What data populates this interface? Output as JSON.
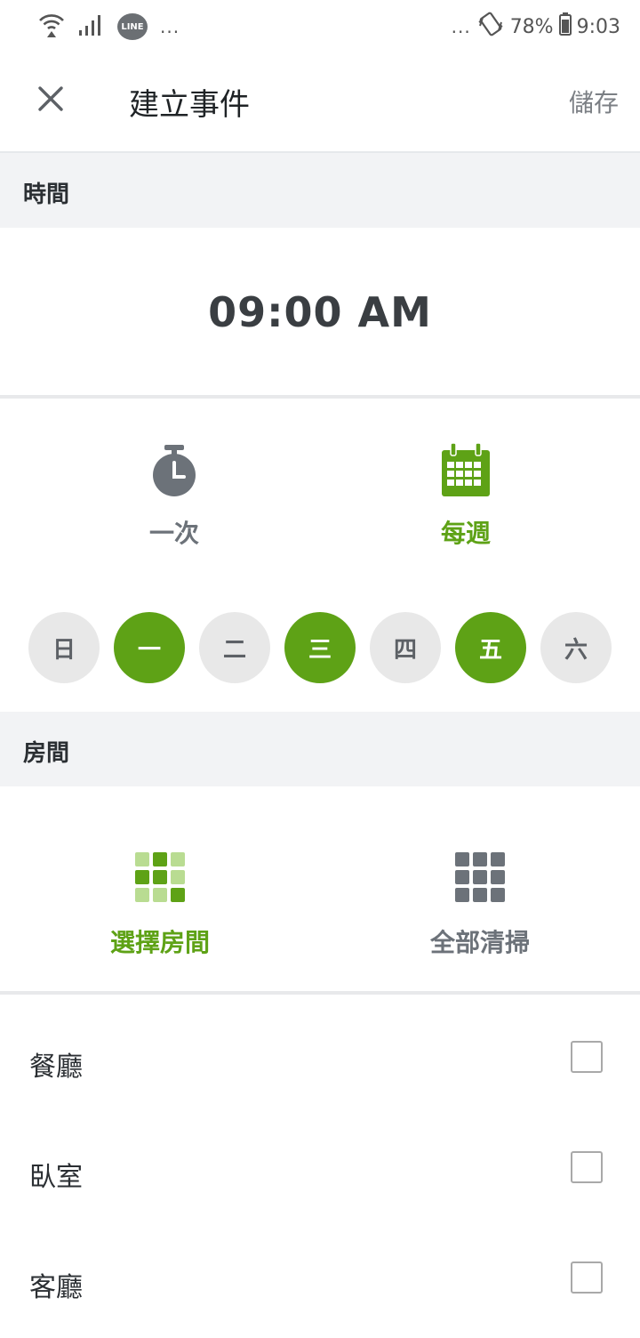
{
  "status_bar": {
    "dots_left": "...",
    "line_label": "LINE",
    "dots_right": "...",
    "battery": "78%",
    "time": "9:03"
  },
  "app_bar": {
    "title": "建立事件",
    "save_label": "儲存"
  },
  "time_section": {
    "header": "時間",
    "time": "09:00 AM"
  },
  "frequency": {
    "once_label": "一次",
    "weekly_label": "每週",
    "selected": "每週"
  },
  "days": [
    {
      "label": "日",
      "selected": false
    },
    {
      "label": "一",
      "selected": true
    },
    {
      "label": "二",
      "selected": false
    },
    {
      "label": "三",
      "selected": true
    },
    {
      "label": "四",
      "selected": false
    },
    {
      "label": "五",
      "selected": true
    },
    {
      "label": "六",
      "selected": false
    }
  ],
  "room_section": {
    "header": "房間",
    "select_label": "選擇房間",
    "all_label": "全部清掃",
    "selected": "選擇房間"
  },
  "rooms": [
    {
      "name": "餐廳",
      "checked": false
    },
    {
      "name": "臥室",
      "checked": false
    },
    {
      "name": "客廳",
      "checked": false
    }
  ],
  "colors": {
    "accent": "#5ea216",
    "accent_light": "#b9dc92",
    "inactive_icon": "#6c7279",
    "day_off": "#e8e8e8"
  }
}
